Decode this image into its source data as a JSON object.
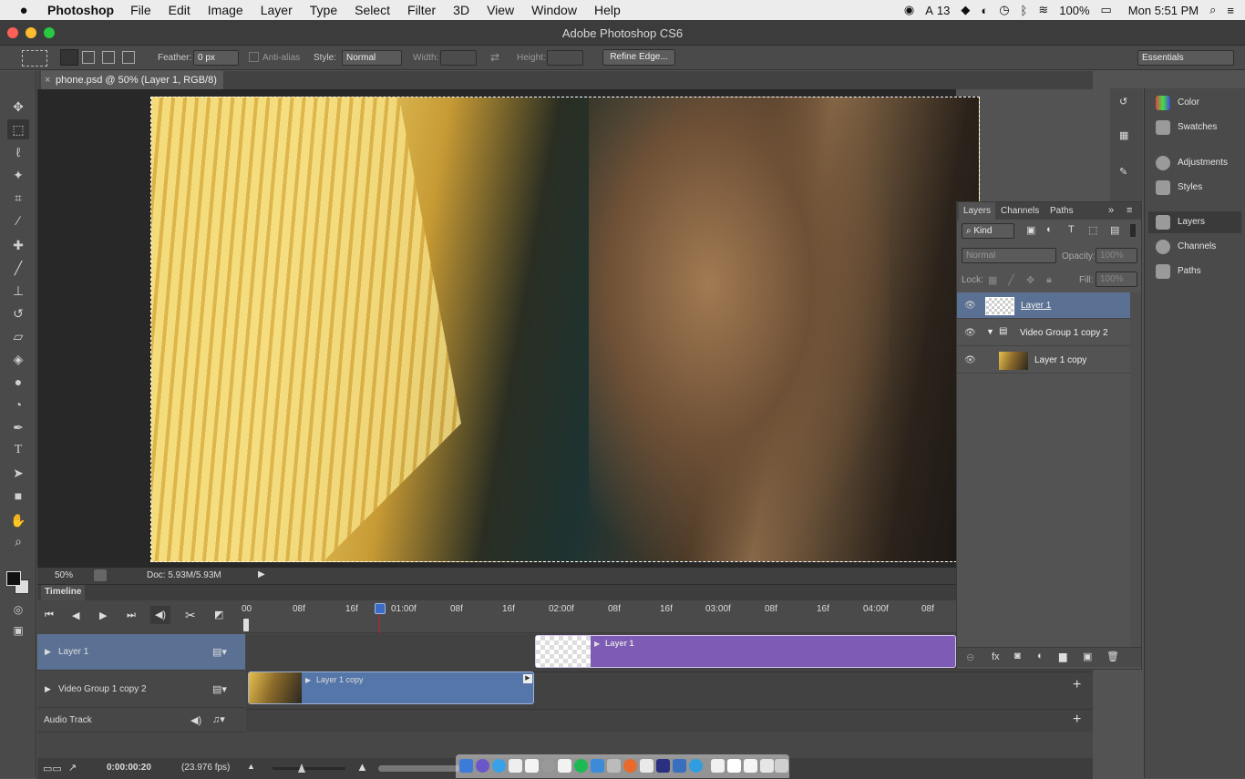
{
  "menubar": {
    "apple": "",
    "app": "Photoshop",
    "items": [
      "File",
      "Edit",
      "Image",
      "Layer",
      "Type",
      "Select",
      "Filter",
      "3D",
      "View",
      "Window",
      "Help"
    ],
    "status": {
      "notif_count": "13",
      "battery": "100%",
      "clock": "Mon 5:51 PM"
    }
  },
  "window": {
    "title": "Adobe Photoshop CS6"
  },
  "options": {
    "feather_label": "Feather:",
    "feather_value": "0 px",
    "antialias_label": "Anti-alias",
    "style_label": "Style:",
    "style_value": "Normal",
    "width_label": "Width:",
    "height_label": "Height:",
    "refine_label": "Refine Edge...",
    "workspace": "Essentials"
  },
  "doc": {
    "tab": "phone.psd @ 50% (Layer 1, RGB/8) *",
    "zoom": "50%",
    "doc_info": "Doc: 5.93M/5.93M"
  },
  "timeline": {
    "title": "Timeline",
    "ticks": [
      "00",
      "08f",
      "16f",
      "01:00f",
      "08f",
      "16f",
      "02:00f",
      "08f",
      "16f",
      "03:00f",
      "08f",
      "16f",
      "04:00f",
      "08f"
    ],
    "tracks": [
      {
        "name": "Layer 1",
        "clip": "Layer 1"
      },
      {
        "name": "Video Group 1 copy 2",
        "clip": "Layer 1 copy"
      },
      {
        "name": "Audio Track"
      }
    ],
    "timecode": "0:00:00:20",
    "fps": "(23.976 fps)"
  },
  "layers": {
    "tabs": [
      "Layers",
      "Channels",
      "Paths"
    ],
    "filter": "Kind",
    "blend": "Normal",
    "opacity_label": "Opacity:",
    "opacity": "100%",
    "lock_label": "Lock:",
    "fill_label": "Fill:",
    "fill": "100%",
    "rows": [
      "Layer 1",
      "Video Group 1 copy 2",
      "Layer 1 copy"
    ]
  },
  "dock": {
    "items": [
      "Color",
      "Swatches",
      "Adjustments",
      "Styles",
      "Layers",
      "Channels",
      "Paths"
    ]
  },
  "colors": {
    "accent": "#7e5bb5",
    "clip_blue": "#5576a8",
    "selected_row": "#5b7193"
  }
}
